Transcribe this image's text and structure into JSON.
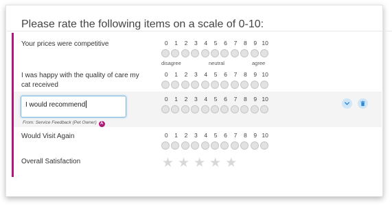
{
  "survey": {
    "title": "Please rate the following items on a scale of 0-10:",
    "scale_numbers": [
      "0",
      "1",
      "2",
      "3",
      "4",
      "5",
      "6",
      "7",
      "8",
      "9",
      "10"
    ],
    "anchors": {
      "low": "disagree",
      "mid": "neutral",
      "high": "agree"
    },
    "items": [
      {
        "label": "Your prices were competitive",
        "type": "scale",
        "show_anchors": true
      },
      {
        "label": "I was happy with the quality of care my cat received",
        "type": "scale"
      },
      {
        "label": "Would Visit Again",
        "type": "scale"
      },
      {
        "label": "Overall Satisfaction",
        "type": "stars",
        "star_count": 5,
        "rating": 0
      }
    ],
    "comment": {
      "value": "I would recommend",
      "source_note": "From: Service Feedback (Pet Owner)",
      "source_badge": "A"
    },
    "icons": {
      "comment_actions": [
        "chevron-down-icon",
        "trash-icon"
      ],
      "star": "star-icon"
    }
  },
  "colors": {
    "accent": "#b0197a",
    "action_icon": "#2e8ad6",
    "action_bg": "#cfe6f8",
    "star_empty": "#d8d8d8"
  }
}
